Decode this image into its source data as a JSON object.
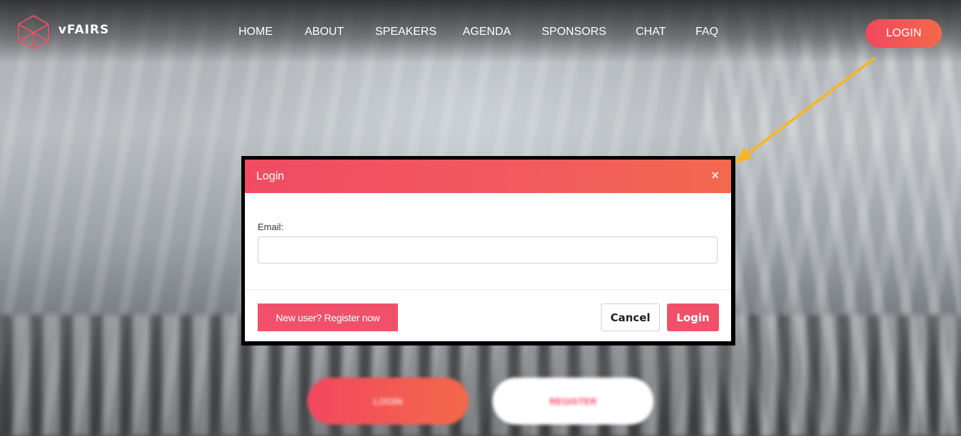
{
  "brand": {
    "name": "vFAIRS",
    "logo_icon": "cube-outline-icon",
    "accent_color": "#f0506a"
  },
  "nav": {
    "items": [
      {
        "label": "HOME"
      },
      {
        "label": "ABOUT"
      },
      {
        "label": "SPEAKERS"
      },
      {
        "label": "AGENDA"
      },
      {
        "label": "SPONSORS"
      },
      {
        "label": "CHAT"
      },
      {
        "label": "FAQ"
      }
    ],
    "login_label": "LOGIN"
  },
  "hero": {
    "login_label": "LOGIN",
    "register_label": "REGISTER"
  },
  "annotation": {
    "arrow_color": "#f0b72b"
  },
  "modal": {
    "title": "Login",
    "close_glyph": "×",
    "email_label": "Email:",
    "email_value": "",
    "register_label": "New user? Register now",
    "cancel_label": "Cancel",
    "login_label": "Login"
  }
}
